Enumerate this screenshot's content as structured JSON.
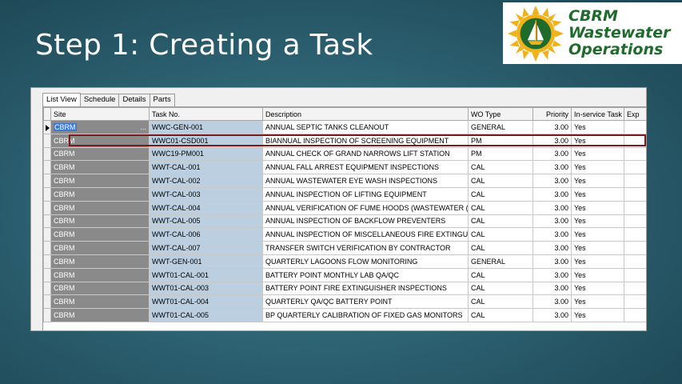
{
  "slide": {
    "title": "Step 1: Creating a Task"
  },
  "logo": {
    "line1": "CBRM",
    "line2": "Wastewater",
    "line3": "Operations",
    "brand_color": "#1e6b2c",
    "accent_color": "#f0b21a"
  },
  "tabs": [
    {
      "label": "List View",
      "active": true
    },
    {
      "label": "Schedule"
    },
    {
      "label": "Details"
    },
    {
      "label": "Parts"
    }
  ],
  "grid": {
    "columns": {
      "site": "Site",
      "task_no": "Task No.",
      "description": "Description",
      "wo_type": "WO Type",
      "priority": "Priority",
      "in_service": "In-service Task",
      "exp": "Exp"
    },
    "rows": [
      {
        "site": "CBRM",
        "task_no": "WWC-GEN-001",
        "description": "ANNUAL SEPTIC TANKS CLEANOUT",
        "wo_type": "GENERAL",
        "priority": "3.00",
        "in_service": "Yes"
      },
      {
        "site": "CBRM",
        "task_no": "WWC01-CSD001",
        "description": "BIANNUAL INSPECTION OF SCREENING EQUIPMENT",
        "wo_type": "PM",
        "priority": "3.00",
        "in_service": "Yes"
      },
      {
        "site": "CBRM",
        "task_no": "WWC19-PM001",
        "description": "ANNUAL CHECK OF GRAND NARROWS LIFT STATION",
        "wo_type": "PM",
        "priority": "3.00",
        "in_service": "Yes"
      },
      {
        "site": "CBRM",
        "task_no": "WWT-CAL-001",
        "description": "ANNUAL FALL ARREST EQUIPMENT INSPECTIONS",
        "wo_type": "CAL",
        "priority": "3.00",
        "in_service": "Yes"
      },
      {
        "site": "CBRM",
        "task_no": "WWT-CAL-002",
        "description": "ANNUAL WASTEWATER EYE WASH INSPECTIONS",
        "wo_type": "CAL",
        "priority": "3.00",
        "in_service": "Yes"
      },
      {
        "site": "CBRM",
        "task_no": "WWT-CAL-003",
        "description": "ANNUAL INSPECTION OF LIFTING EQUIPMENT",
        "wo_type": "CAL",
        "priority": "3.00",
        "in_service": "Yes"
      },
      {
        "site": "CBRM",
        "task_no": "WWT-CAL-004",
        "description": "ANNUAL VERIFICATION OF FUME HOODS (WASTEWATER (",
        "wo_type": "CAL",
        "priority": "3.00",
        "in_service": "Yes"
      },
      {
        "site": "CBRM",
        "task_no": "WWT-CAL-005",
        "description": "ANNUAL INSPECTION OF BACKFLOW PREVENTERS",
        "wo_type": "CAL",
        "priority": "3.00",
        "in_service": "Yes"
      },
      {
        "site": "CBRM",
        "task_no": "WWT-CAL-006",
        "description": "ANNUAL INSPECTION OF MISCELLANEOUS FIRE EXTINGUI",
        "wo_type": "CAL",
        "priority": "3.00",
        "in_service": "Yes"
      },
      {
        "site": "CBRM",
        "task_no": "WWT-CAL-007",
        "description": "TRANSFER SWITCH VERIFICATION BY CONTRACTOR",
        "wo_type": "CAL",
        "priority": "3.00",
        "in_service": "Yes"
      },
      {
        "site": "CBRM",
        "task_no": "WWT-GEN-001",
        "description": "QUARTERLY LAGOONS FLOW MONITORING",
        "wo_type": "GENERAL",
        "priority": "3.00",
        "in_service": "Yes"
      },
      {
        "site": "CBRM",
        "task_no": "WWT01-CAL-001",
        "description": "BATTERY POINT MONTHLY LAB QA/QC",
        "wo_type": "CAL",
        "priority": "3.00",
        "in_service": "Yes"
      },
      {
        "site": "CBRM",
        "task_no": "WWT01-CAL-003",
        "description": "BATTERY POINT FIRE EXTINGUISHER INSPECTIONS",
        "wo_type": "CAL",
        "priority": "3.00",
        "in_service": "Yes"
      },
      {
        "site": "CBRM",
        "task_no": "WWT01-CAL-004",
        "description": "QUARTERLY QA/QC BATTERY POINT",
        "wo_type": "CAL",
        "priority": "3.00",
        "in_service": "Yes"
      },
      {
        "site": "CBRM",
        "task_no": "WWT01-CAL-005",
        "description": "BP QUARTERLY CALIBRATION OF FIXED GAS MONITORS",
        "wo_type": "CAL",
        "priority": "3.00",
        "in_service": "Yes"
      }
    ],
    "ellipsis": "..."
  }
}
